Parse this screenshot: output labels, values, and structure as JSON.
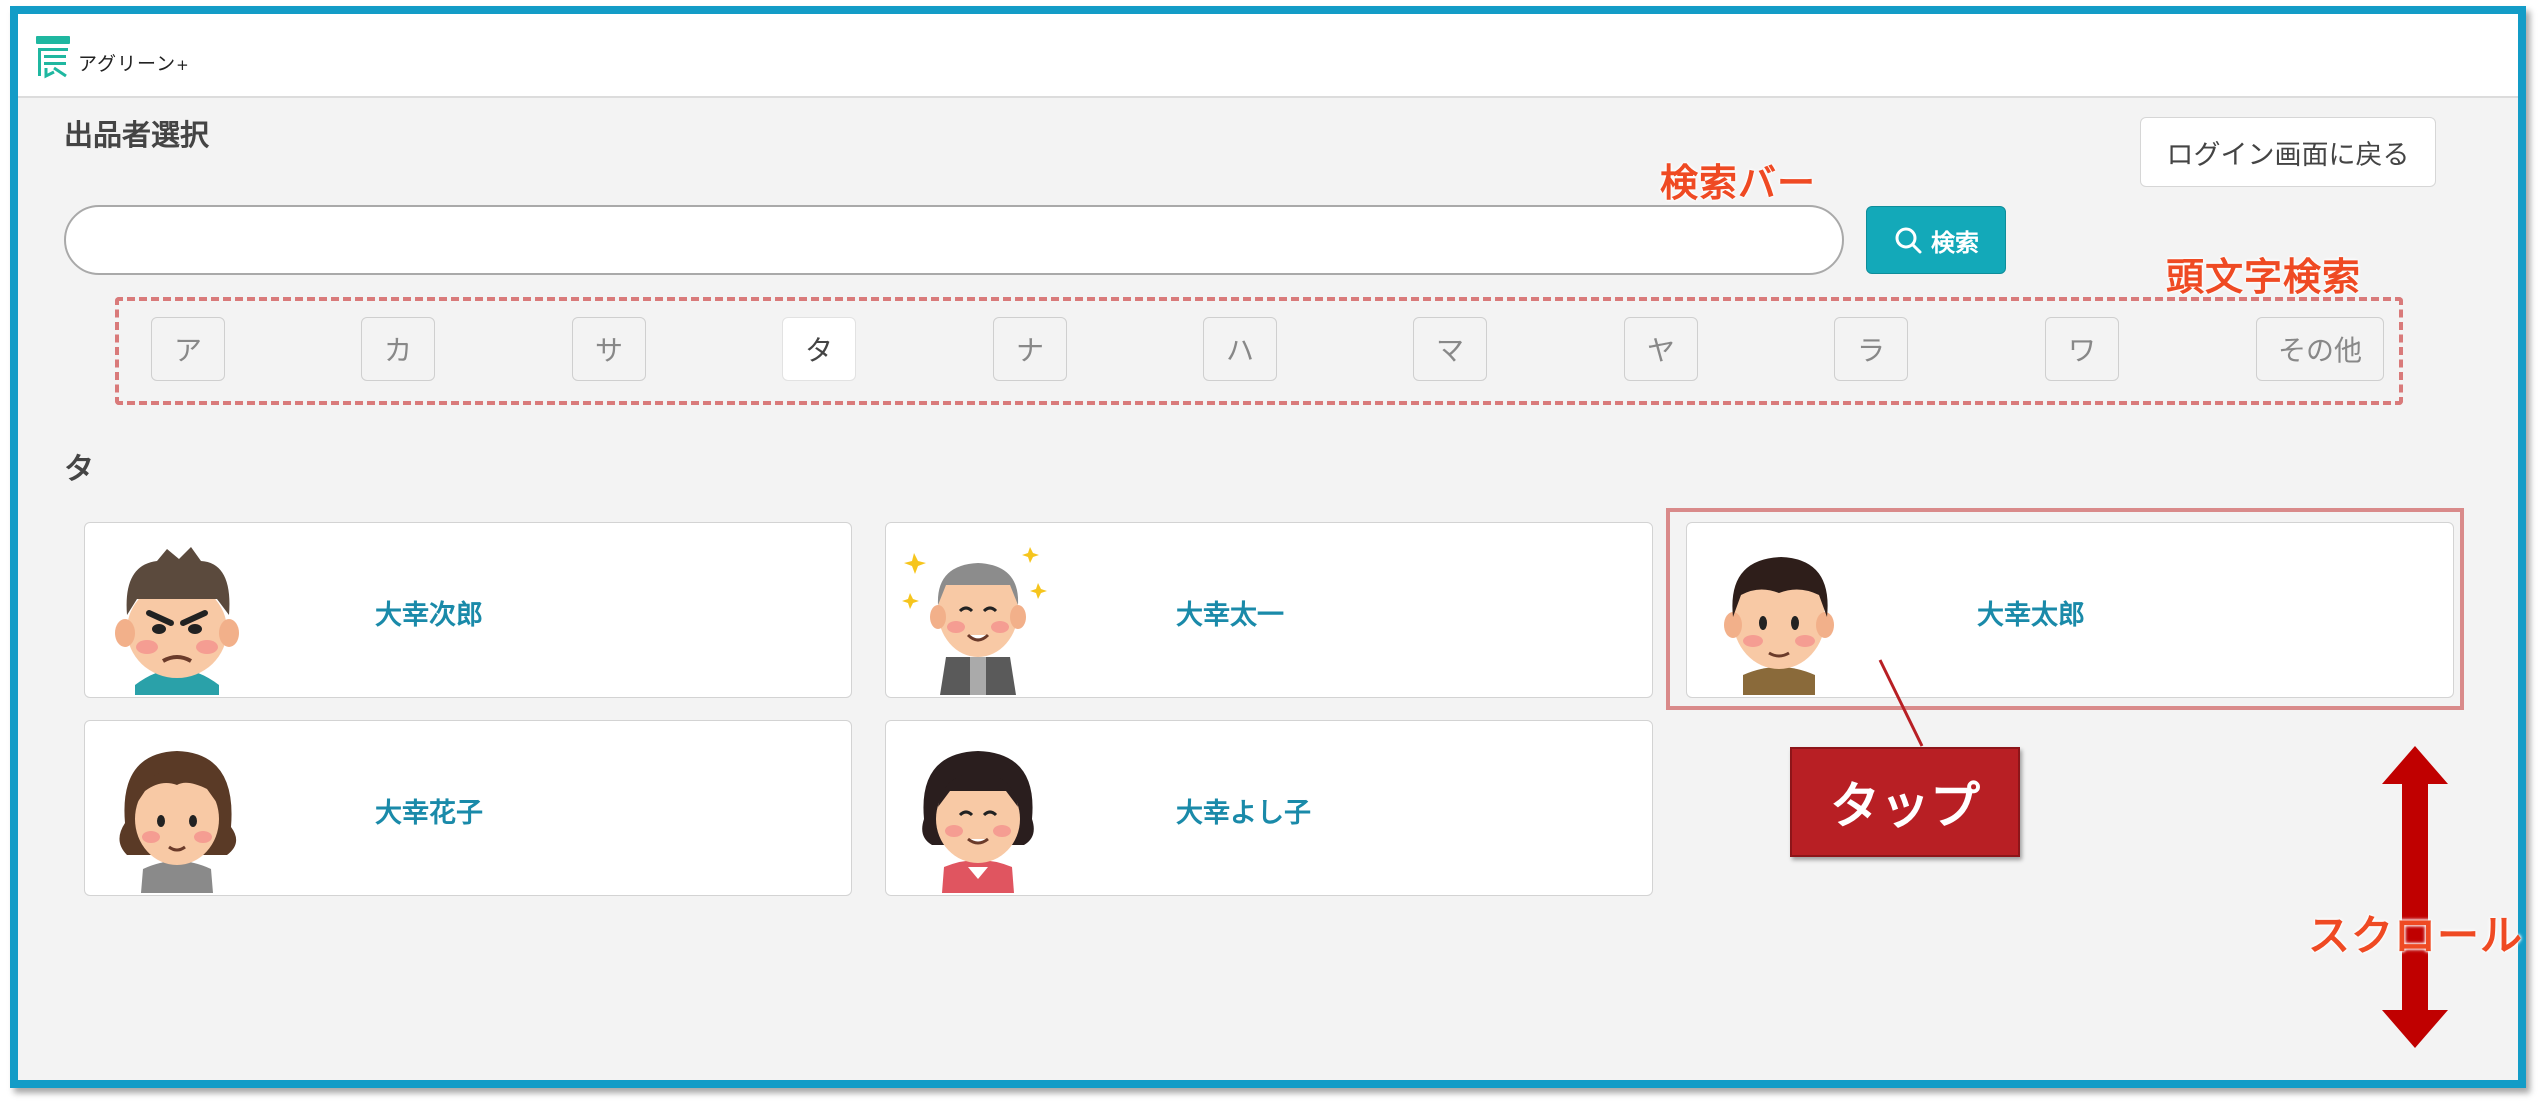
{
  "header": {
    "logo_text": "アグリーン",
    "logo_plus": "+"
  },
  "page": {
    "title": "出品者選択",
    "back_label": "ログイン画面に戻る"
  },
  "search": {
    "placeholder": "",
    "value": "",
    "button_label": "検索"
  },
  "kana_filter": {
    "active": "タ",
    "items": [
      "ア",
      "カ",
      "サ",
      "タ",
      "ナ",
      "ハ",
      "マ",
      "ヤ",
      "ラ",
      "ワ",
      "その他"
    ]
  },
  "section": {
    "letter": "タ"
  },
  "sellers": [
    {
      "name": "大幸次郎",
      "icon": "angry-man-avatar"
    },
    {
      "name": "大幸太一",
      "icon": "elderly-man-avatar"
    },
    {
      "name": "大幸太郎",
      "icon": "young-man-avatar"
    },
    {
      "name": "大幸花子",
      "icon": "woman-avatar"
    },
    {
      "name": "大幸よし子",
      "icon": "elderly-woman-avatar"
    }
  ],
  "annotations": {
    "search_bar": "検索バー",
    "initial_search": "頭文字検索",
    "tap": "タップ",
    "scroll": "スクロール"
  },
  "colors": {
    "frame": "#139cc7",
    "accent": "#13a9b9",
    "name": "#1a8aa9",
    "callout": "#b81f24",
    "annotation": "#ef4a23"
  }
}
